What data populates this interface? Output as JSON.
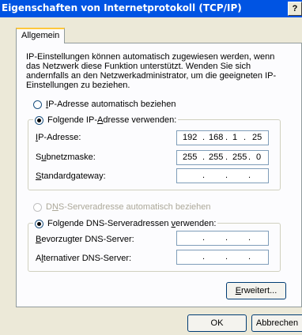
{
  "window": {
    "title": "Eigenschaften von Internetprotokoll (TCP/IP)",
    "help_label": "?"
  },
  "tabs": [
    {
      "label": "Allgemein",
      "selected": true
    }
  ],
  "intro_text": "IP-Einstellungen können automatisch zugewiesen werden, wenn das Netzwerk diese Funktion unterstützt. Wenden Sie sich andernfalls an den Netzwerkadministrator, um die geeigneten IP-Einstellungen zu beziehen.",
  "ip_mode": {
    "auto": {
      "pre": "",
      "accel": "I",
      "post": "P-Adresse automatisch beziehen",
      "selected": false
    },
    "manual": {
      "pre": "Folgende IP-",
      "accel": "A",
      "post": "dresse verwenden:",
      "selected": true
    }
  },
  "ip_fields": [
    {
      "pre": "",
      "accel": "I",
      "post": "P-Adresse:",
      "octets": [
        "192",
        "168",
        "1",
        "25"
      ]
    },
    {
      "pre": "S",
      "accel": "u",
      "post": "bnetzmaske:",
      "octets": [
        "255",
        "255",
        "255",
        "0"
      ]
    },
    {
      "pre": "",
      "accel": "S",
      "post": "tandardgateway:",
      "octets": [
        "",
        "",
        "",
        ""
      ]
    }
  ],
  "dns_mode": {
    "auto": {
      "pre": "D",
      "accel": "N",
      "post": "S-Serveradresse automatisch beziehen",
      "selected": false,
      "enabled": false
    },
    "manual": {
      "pre": "Folgende DNS-Serveradressen ",
      "accel": "v",
      "post": "erwenden:",
      "selected": true
    }
  },
  "dns_fields": [
    {
      "pre": "",
      "accel": "B",
      "post": "evorzugter DNS-Server:",
      "octets": [
        "",
        "",
        "",
        ""
      ]
    },
    {
      "pre": "A",
      "accel": "l",
      "post": "ternativer DNS-Server:",
      "octets": [
        "",
        "",
        "",
        ""
      ]
    }
  ],
  "buttons": {
    "advanced": {
      "pre": "",
      "accel": "E",
      "post": "rweitert..."
    },
    "ok": "OK",
    "cancel": "Abbrechen"
  },
  "colors": {
    "titlebar": "#0054e3",
    "dialog_bg": "#ece9d8",
    "panel_bg": "#fcfcfe",
    "input_border": "#7f9db9",
    "disabled_text": "#aca899"
  }
}
